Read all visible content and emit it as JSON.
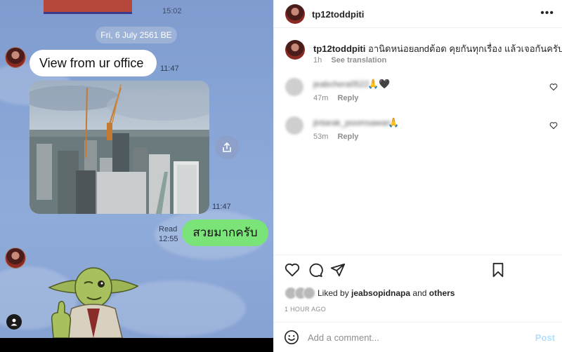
{
  "chat": {
    "previous_time": "15:02",
    "date_separator": "Fri, 6 July 2561 BE",
    "incoming_text": "View from ur office",
    "incoming_text_time": "11:47",
    "photo_time": "11:47",
    "read_label": "Read",
    "read_time": "12:55",
    "outgoing_text": "สวยมากครับ",
    "icons": [
      "share-icon",
      "person-icon"
    ]
  },
  "post": {
    "username": "tp12toddpiti",
    "more_icon": "more-horizontal-icon",
    "caption_username": "tp12toddpiti",
    "caption_text": "อานิดหน่อยandต้อด คุยกันทุกเรื่อง แล้วเจอกันครับ🙏",
    "caption_age": "1h",
    "see_translation": "See translation",
    "comments": [
      {
        "username": "jeabchera0522",
        "text": "🙏🖤",
        "age": "47m",
        "reply": "Reply"
      },
      {
        "username": "jintarak_poomsawan",
        "text": "🙏",
        "age": "53m",
        "reply": "Reply"
      }
    ],
    "liked_by_prefix": "Liked by",
    "liked_by_user": "jeabsopidnapa",
    "liked_by_and": "and",
    "liked_by_others": "others",
    "posted_ago": "1 HOUR AGO",
    "comment_placeholder": "Add a comment...",
    "post_label": "Post",
    "action_icons": [
      "heart-icon",
      "comment-icon",
      "share-icon",
      "bookmark-icon"
    ],
    "colors": {
      "link_blue_disabled": "#b2dffc",
      "muted_text": "#8e8e8e",
      "outgoing_bubble": "#7ae478"
    }
  }
}
